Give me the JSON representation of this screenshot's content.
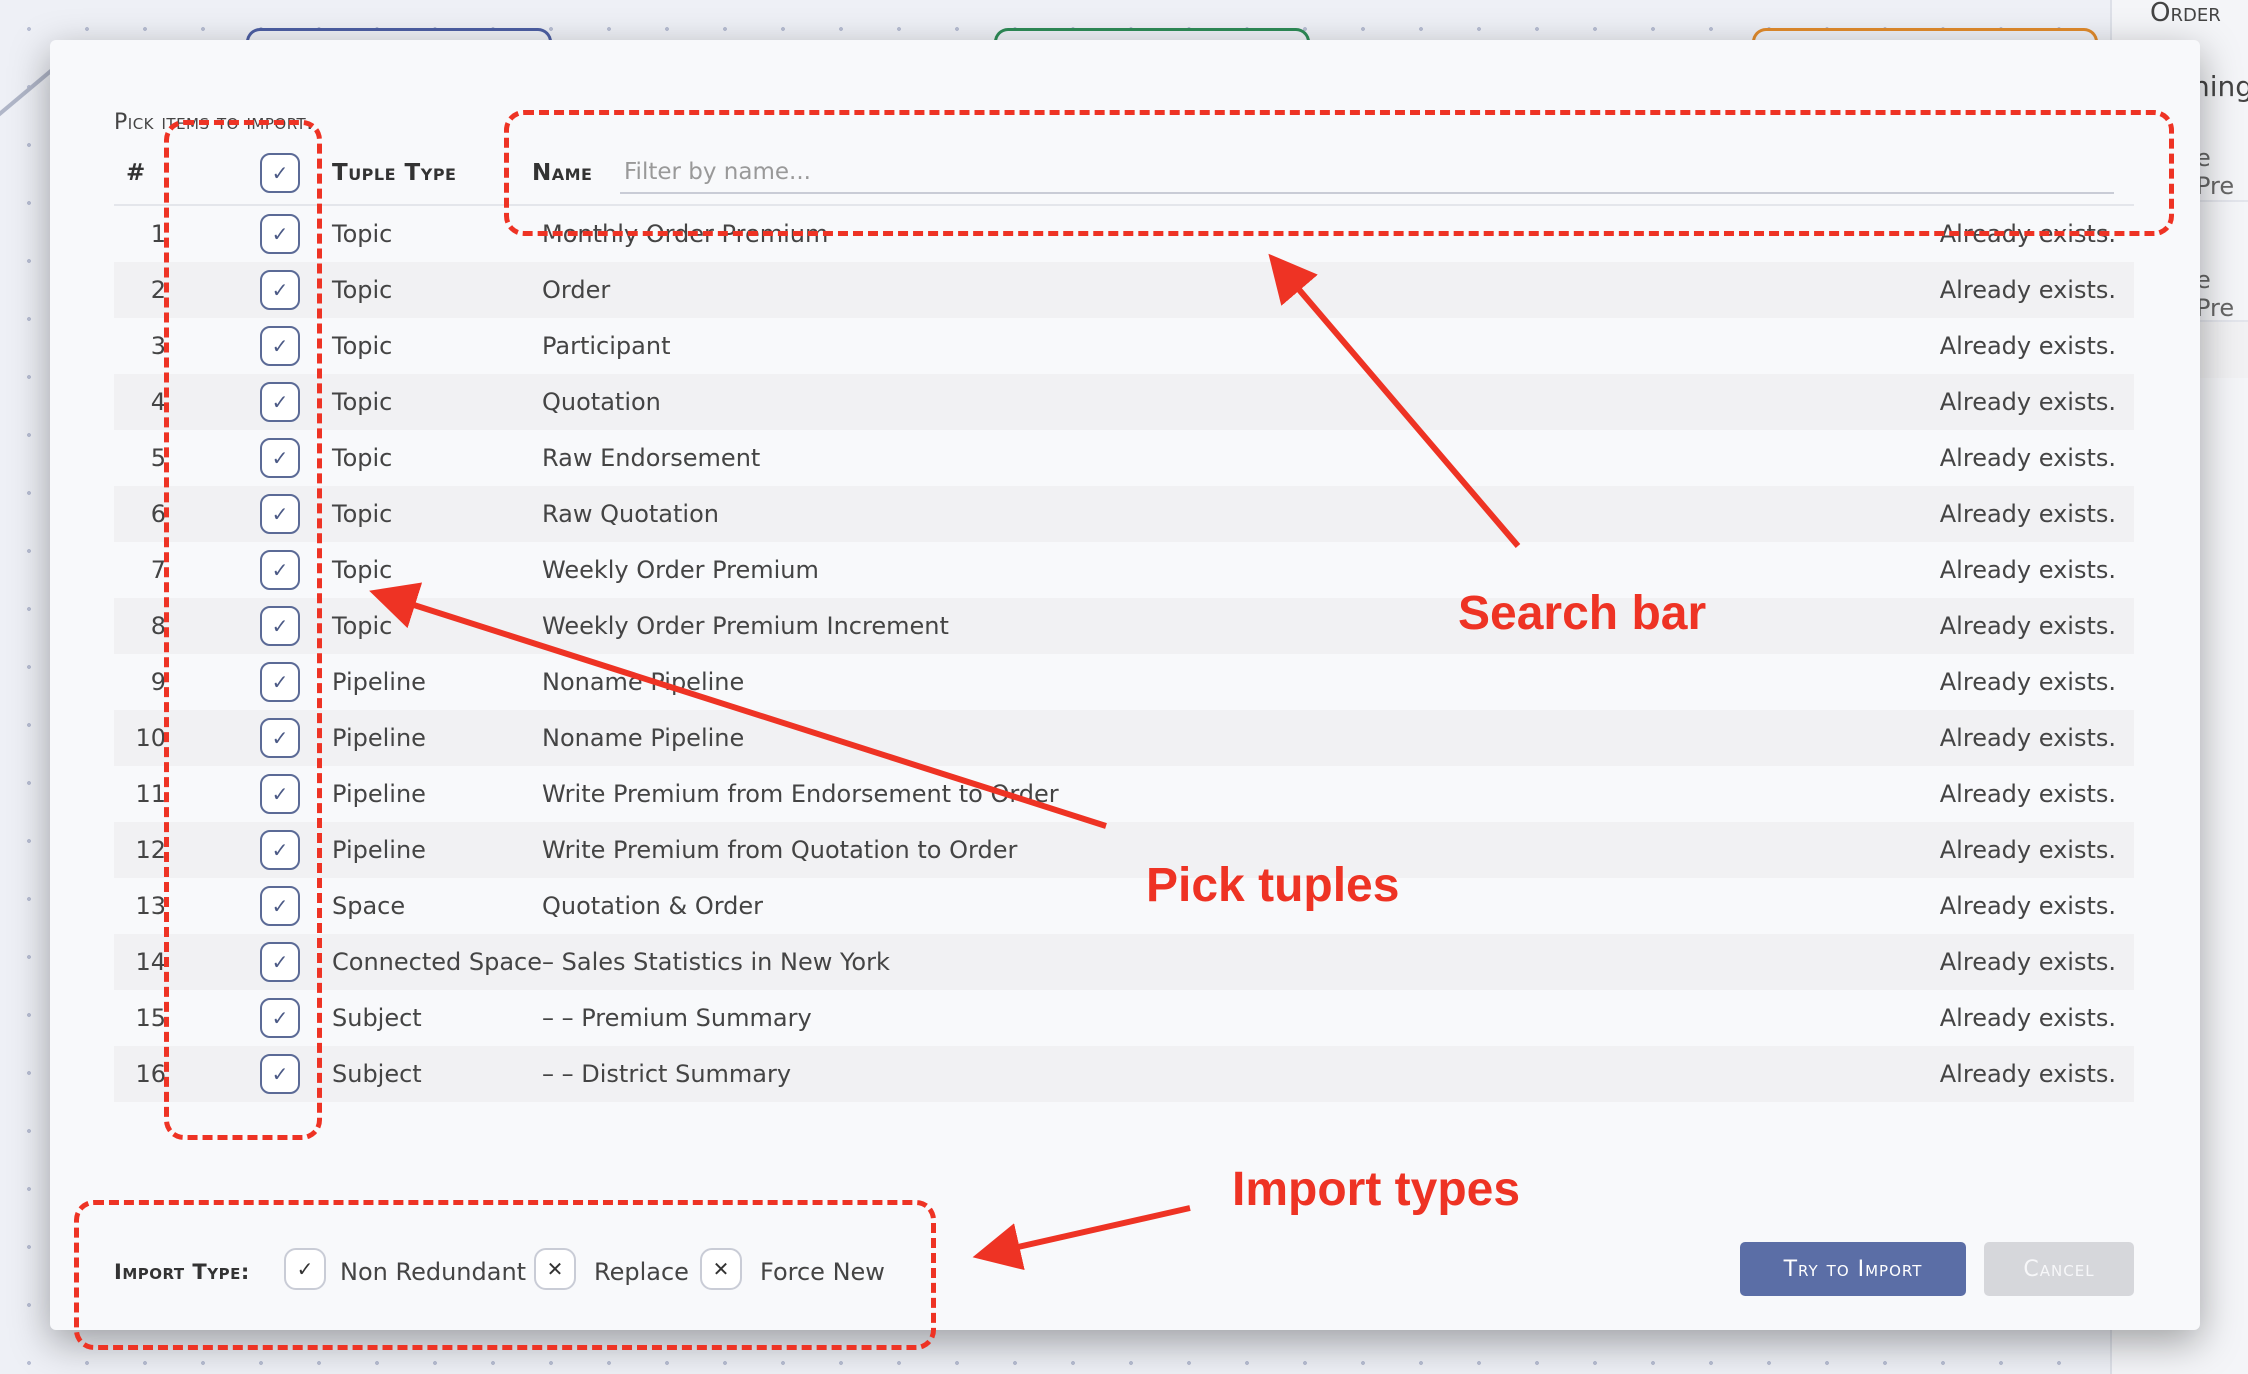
{
  "background": {
    "right_panel": {
      "title": "Order",
      "line1": "ning",
      "line2": "e Pre",
      "line3": "e Pre"
    }
  },
  "dialog": {
    "pick_label": "Pick items to import.",
    "columns": {
      "index": "#",
      "tuple_type": "Tuple Type",
      "name": "Name"
    },
    "search": {
      "placeholder": "Filter by name..."
    },
    "rows": [
      {
        "index": "1",
        "type": "Topic",
        "name": "Monthly Order Premium",
        "status": "Already exists."
      },
      {
        "index": "2",
        "type": "Topic",
        "name": "Order",
        "status": "Already exists."
      },
      {
        "index": "3",
        "type": "Topic",
        "name": "Participant",
        "status": "Already exists."
      },
      {
        "index": "4",
        "type": "Topic",
        "name": "Quotation",
        "status": "Already exists."
      },
      {
        "index": "5",
        "type": "Topic",
        "name": "Raw Endorsement",
        "status": "Already exists."
      },
      {
        "index": "6",
        "type": "Topic",
        "name": "Raw Quotation",
        "status": "Already exists."
      },
      {
        "index": "7",
        "type": "Topic",
        "name": "Weekly Order Premium",
        "status": "Already exists."
      },
      {
        "index": "8",
        "type": "Topic",
        "name": "Weekly Order Premium Increment",
        "status": "Already exists."
      },
      {
        "index": "9",
        "type": "Pipeline",
        "name": "Noname Pipeline",
        "status": "Already exists."
      },
      {
        "index": "10",
        "type": "Pipeline",
        "name": "Noname Pipeline",
        "status": "Already exists."
      },
      {
        "index": "11",
        "type": "Pipeline",
        "name": "Write Premium from Endorsement to Order",
        "status": "Already exists."
      },
      {
        "index": "12",
        "type": "Pipeline",
        "name": "Write Premium from Quotation to Order",
        "status": "Already exists."
      },
      {
        "index": "13",
        "type": "Space",
        "name": "Quotation & Order",
        "status": "Already exists."
      },
      {
        "index": "14",
        "type": "Connected Space",
        "name": "–  Sales Statistics in New York",
        "status": "Already exists."
      },
      {
        "index": "15",
        "type": "Subject",
        "name": "– –  Premium Summary",
        "status": "Already exists."
      },
      {
        "index": "16",
        "type": "Subject",
        "name": "– –  District Summary",
        "status": "Already exists."
      }
    ],
    "import_type": {
      "label": "Import Type:",
      "options": [
        {
          "label": "Non Redundant",
          "checked": true
        },
        {
          "label": "Replace",
          "checked": false
        },
        {
          "label": "Force New",
          "checked": false
        }
      ]
    },
    "buttons": {
      "import": "Try to Import",
      "cancel": "Cancel"
    }
  },
  "annotations": {
    "search_bar": "Search bar",
    "pick_tuples": "Pick tuples",
    "import_types": "Import types",
    "color": "#ee3324"
  },
  "icons": {
    "checked": "check-icon",
    "unchecked": "x-icon"
  }
}
